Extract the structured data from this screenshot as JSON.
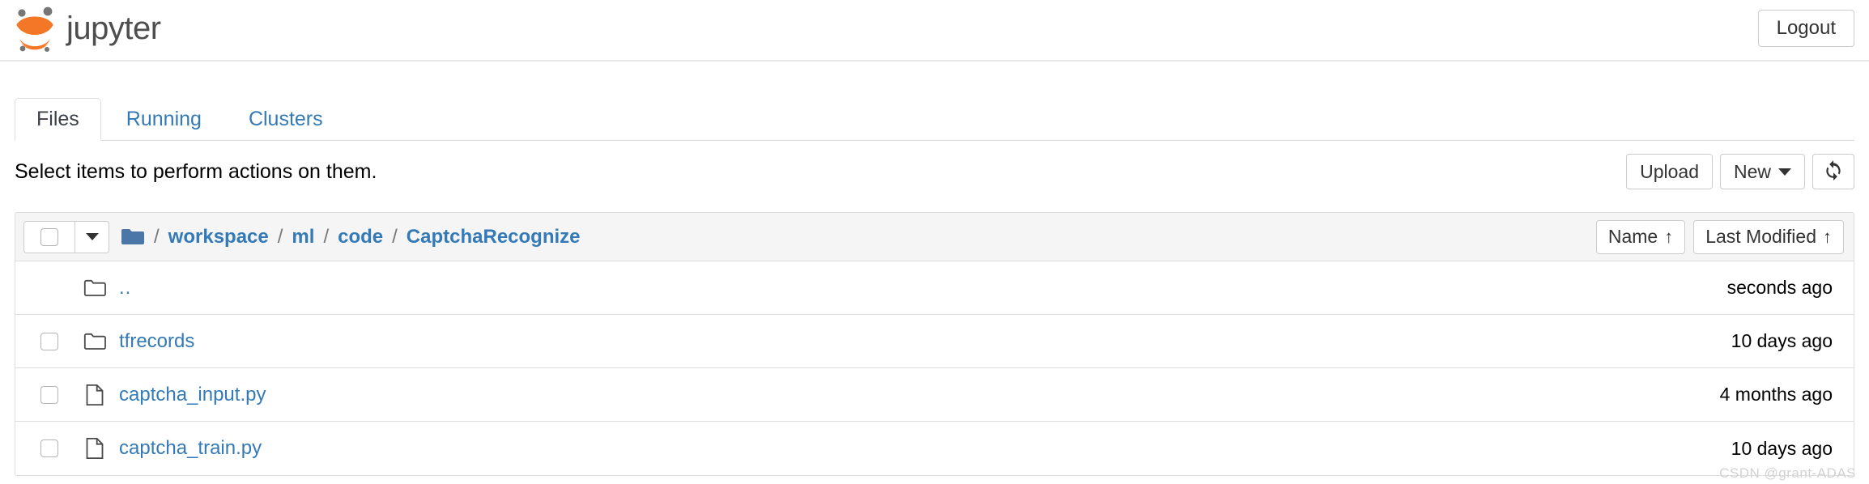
{
  "header": {
    "brand_text": "jupyter",
    "logo_icon": "jupyter-logo",
    "logout_label": "Logout"
  },
  "tabs": [
    {
      "label": "Files",
      "active": true
    },
    {
      "label": "Running",
      "active": false
    },
    {
      "label": "Clusters",
      "active": false
    }
  ],
  "toolbar": {
    "message": "Select items to perform actions on them.",
    "upload_label": "Upload",
    "new_label": "New",
    "new_caret_icon": "chevron-down-icon",
    "refresh_icon": "refresh-icon"
  },
  "list_header": {
    "select_all_checkbox": "",
    "select_caret_icon": "chevron-down-icon",
    "folder_icon": "folder-solid-icon",
    "breadcrumb": [
      {
        "label": "workspace"
      },
      {
        "label": "ml"
      },
      {
        "label": "code"
      },
      {
        "label": "CaptchaRecognize"
      }
    ],
    "separator": "/",
    "sort_name_label": "Name",
    "sort_name_arrow": "↑",
    "sort_modified_label": "Last Modified",
    "sort_modified_arrow": "↑"
  },
  "files": [
    {
      "name": "..",
      "icon": "folder-outline-icon",
      "kind": "parent-directory",
      "checkbox": false,
      "modified": "seconds ago"
    },
    {
      "name": "tfrecords",
      "icon": "folder-outline-icon",
      "kind": "directory",
      "checkbox": true,
      "modified": "10 days ago"
    },
    {
      "name": "captcha_input.py",
      "icon": "file-icon",
      "kind": "file",
      "checkbox": true,
      "modified": "4 months ago"
    },
    {
      "name": "captcha_train.py",
      "icon": "file-icon",
      "kind": "file",
      "checkbox": true,
      "modified": "10 days ago"
    }
  ],
  "watermark": {
    "text": "CSDN @grant-ADAS"
  },
  "colors": {
    "link": "#337ab7",
    "brand_orange": "#f37726",
    "logo_gray": "#767677",
    "text": "#333333",
    "border": "#dddddd",
    "header_bg": "#f5f5f5"
  }
}
